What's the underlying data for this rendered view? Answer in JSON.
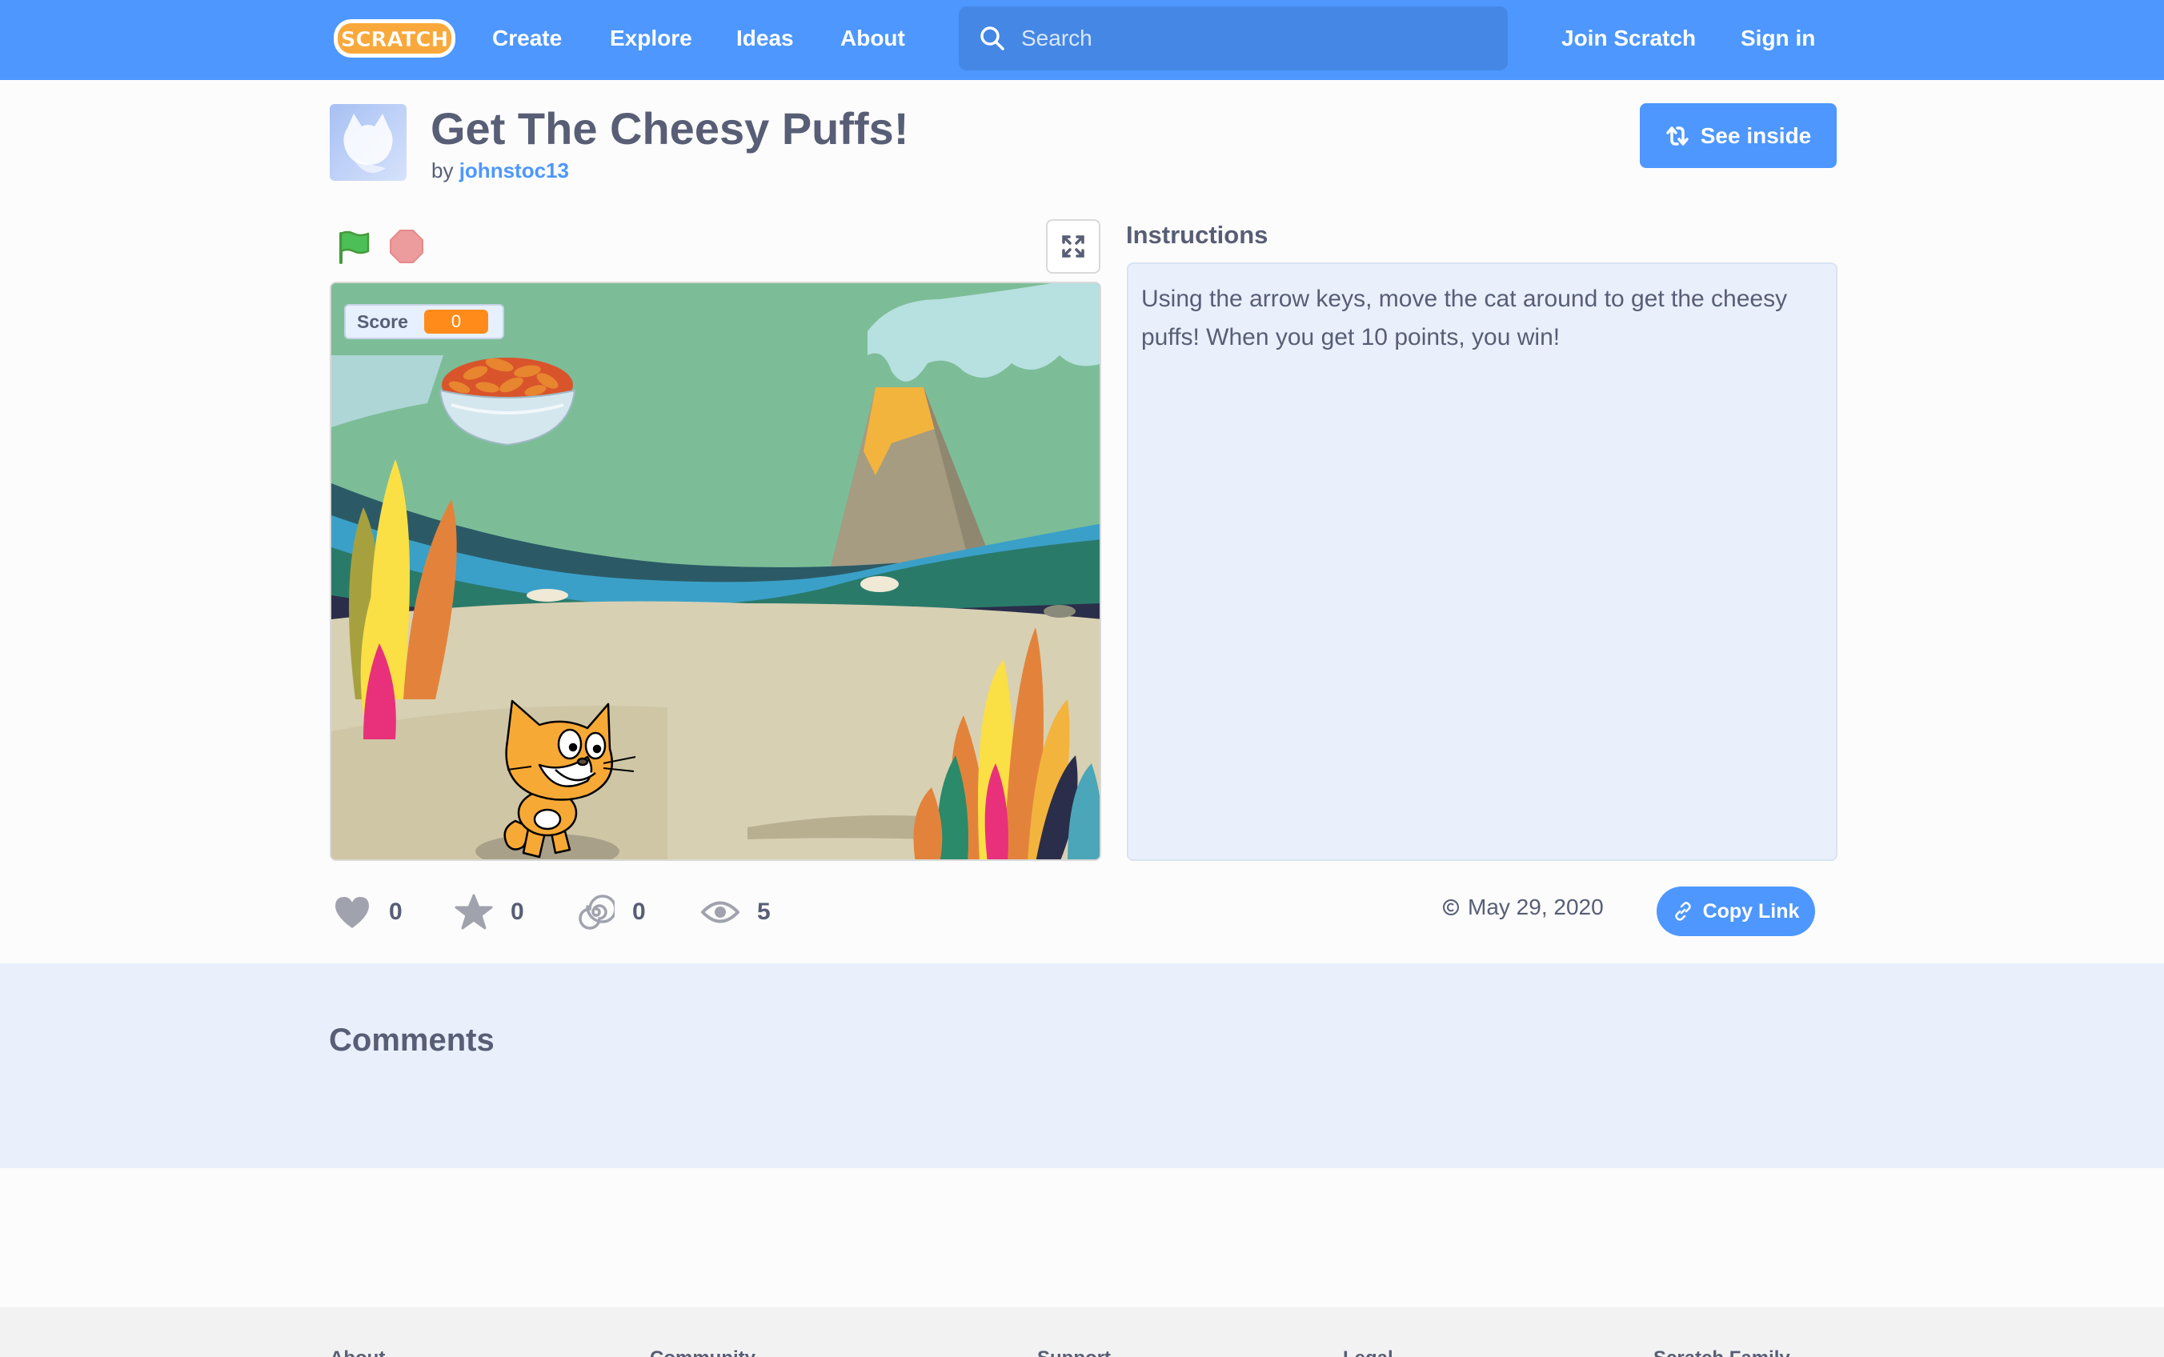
{
  "navbar": {
    "logo_text": "SCRATCH",
    "links": [
      "Create",
      "Explore",
      "Ideas",
      "About"
    ],
    "search_placeholder": "Search",
    "join_label": "Join Scratch",
    "signin_label": "Sign in",
    "bg_color": "#4d97ff"
  },
  "project": {
    "title": "Get The Cheesy Puffs!",
    "by_label": "by",
    "author": "johnstoc13",
    "see_inside_label": "See inside"
  },
  "stage": {
    "score_label": "Score",
    "score_value": "0"
  },
  "instructions": {
    "heading": "Instructions",
    "text": "Using the arrow keys, move the cat around to get the cheesy puffs! When you get 10 points, you win!"
  },
  "stats": {
    "loves": "0",
    "favorites": "0",
    "remixes": "0",
    "views": "5"
  },
  "share": {
    "date": "May 29, 2020",
    "copy_link_label": "Copy Link"
  },
  "comments": {
    "heading": "Comments"
  },
  "footer": {
    "columns": [
      "About",
      "Community",
      "Support",
      "Legal",
      "Scratch Family"
    ]
  }
}
